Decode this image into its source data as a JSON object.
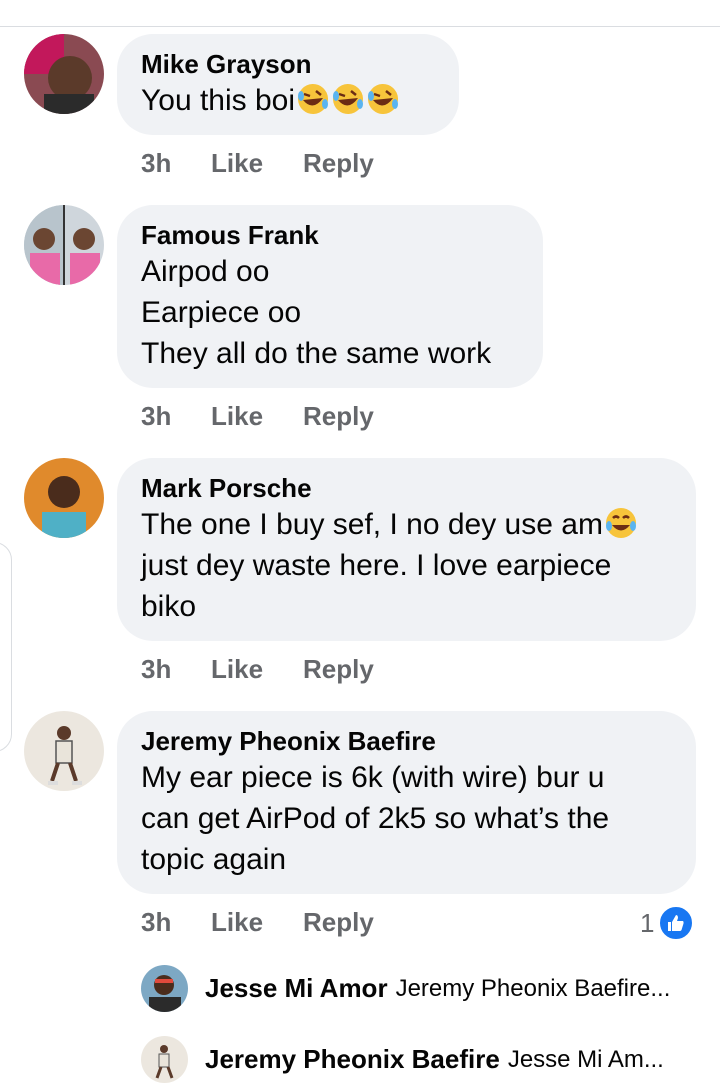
{
  "comments": [
    {
      "name": "Mike Grayson",
      "lines": [
        "You this boi"
      ],
      "emoji": [
        "rolling-on-floor-laughing-icon",
        "rolling-on-floor-laughing-icon",
        "rolling-on-floor-laughing-icon"
      ],
      "time": "3h",
      "like": "Like",
      "reply": "Reply"
    },
    {
      "name": "Famous Frank",
      "lines": [
        "Airpod oo",
        "Earpiece oo",
        "They all do the same work"
      ],
      "time": "3h",
      "like": "Like",
      "reply": "Reply"
    },
    {
      "name": "Mark Porsche",
      "lines": [
        "The one I buy sef, I no dey use am",
        "just dey waste here. I love earpiece",
        "biko"
      ],
      "emoji": [
        "tears-of-joy-icon"
      ],
      "time": "3h",
      "like": "Like",
      "reply": "Reply"
    },
    {
      "name": "Jeremy Pheonix Baefire",
      "lines": [
        "My ear piece is 6k (with wire) bur u",
        "can get AirPod of 2k5 so what’s the",
        "topic again"
      ],
      "time": "3h",
      "like": "Like",
      "reply": "Reply",
      "reaction_count": "1"
    }
  ],
  "replies": [
    {
      "name": "Jesse Mi Amor",
      "preview": "Jeremy Pheonix Baefire..."
    },
    {
      "name": "Jeremy Pheonix Baefire",
      "preview": "Jesse Mi Am..."
    }
  ],
  "colors": {
    "bubble": "#f0f2f5",
    "meta": "#65676b",
    "like_blue": "#1877f2"
  }
}
